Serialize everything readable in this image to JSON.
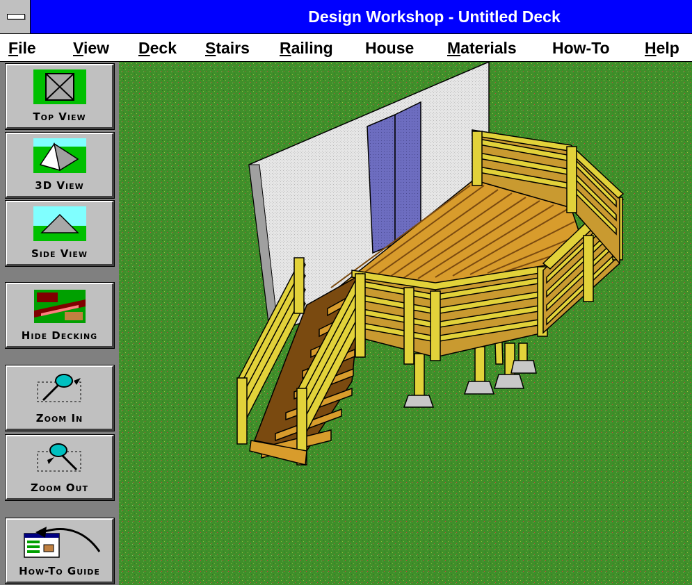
{
  "window": {
    "title": "Design Workshop - Untitled Deck"
  },
  "menu": [
    {
      "label": "File",
      "accel": "F",
      "rest": "ile"
    },
    {
      "label": "View",
      "accel": "V",
      "rest": "iew"
    },
    {
      "label": "Deck",
      "accel": "D",
      "rest": "eck"
    },
    {
      "label": "Stairs",
      "accel": "S",
      "rest": "tairs"
    },
    {
      "label": "Railing",
      "accel": "R",
      "rest": "ailing"
    },
    {
      "label": "House",
      "accel": "",
      "rest": "House"
    },
    {
      "label": "Materials",
      "accel": "M",
      "rest": "aterials"
    },
    {
      "label": "How-To",
      "accel": "",
      "rest": "How-To"
    },
    {
      "label": "Help",
      "accel": "H",
      "rest": "elp"
    }
  ],
  "toolbar": {
    "top_view": "Top View",
    "view_3d": "3D View",
    "side_view": "Side View",
    "hide_decking": "Hide Decking",
    "zoom_in": "Zoom In",
    "zoom_out": "Zoom Out",
    "how_to_guide": "How-To Guide"
  },
  "colors": {
    "title_bar": "#0000ff",
    "grass": "#3f8f2a",
    "deck_wood": "#d89c2c",
    "rail_wood": "#e2d23a",
    "house_wall": "#e6e6e6",
    "door": "#6d6dc0",
    "footing": "#c8c8c8"
  }
}
